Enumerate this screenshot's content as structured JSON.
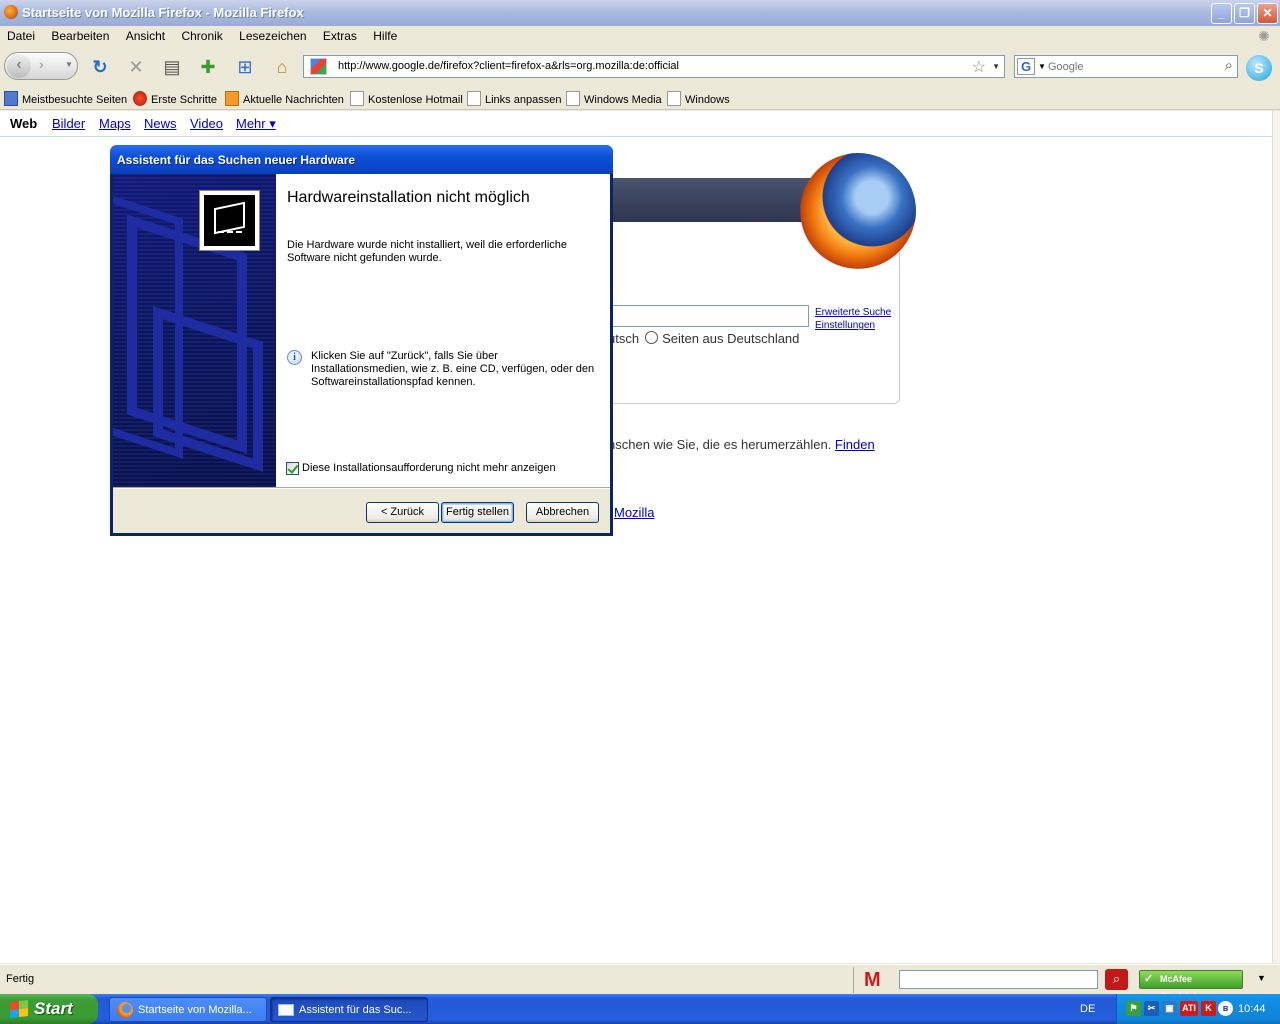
{
  "browser": {
    "window_title": "Startseite von Mozilla Firefox - Mozilla Firefox",
    "menu": [
      "Datei",
      "Bearbeiten",
      "Ansicht",
      "Chronik",
      "Lesezeichen",
      "Extras",
      "Hilfe"
    ],
    "url": "http://www.google.de/firefox?client=firefox-a&rls=org.mozilla:de:official",
    "search_placeholder": "Google",
    "bookmarks": [
      "Meistbesuchte Seiten",
      "Erste Schritte",
      "Aktuelle Nachrichten",
      "Kostenlose Hotmail",
      "Links anpassen",
      "Windows Media",
      "Windows"
    ],
    "status_text": "Fertig"
  },
  "page": {
    "gnav": [
      "Web",
      "Bilder",
      "Maps",
      "News",
      "Video",
      "Mehr ▾"
    ],
    "search_links": [
      "Erweiterte Suche",
      "Einstellungen"
    ],
    "radio_fragment": "utsch",
    "radio_label": "Seiten aus Deutschland",
    "line1_text": "nschen wie Sie, die es herumerzählen.",
    "line1_link": "Finden",
    "line2_link": "Mozilla"
  },
  "dialog": {
    "title": "Assistent für das Suchen neuer Hardware",
    "heading": "Hardwareinstallation nicht möglich",
    "paragraph1": "Die Hardware wurde nicht installiert, weil die erforderliche Software nicht gefunden wurde.",
    "paragraph2": "Klicken Sie auf \"Zurück\", falls Sie über Installationsmedien, wie z. B. eine CD, verfügen, oder den Softwareinstallationspfad kennen.",
    "checkbox_label": "Diese Installationsaufforderung nicht mehr anzeigen",
    "checkbox_checked": true,
    "buttons": {
      "back": "< Zurück",
      "finish": "Fertig stellen",
      "cancel": "Abbrechen"
    }
  },
  "statusbar": {
    "siteadvisor": "McAfee SiteAdvisor"
  },
  "taskbar": {
    "start": "Start",
    "tasks": [
      "Startseite von Mozilla...",
      "Assistent für das Suc..."
    ],
    "language": "DE",
    "clock": "10:44"
  },
  "colors": {
    "xp_blue": "#245edc",
    "dialog_title": "#0a47c8",
    "link": "#0000cc"
  }
}
